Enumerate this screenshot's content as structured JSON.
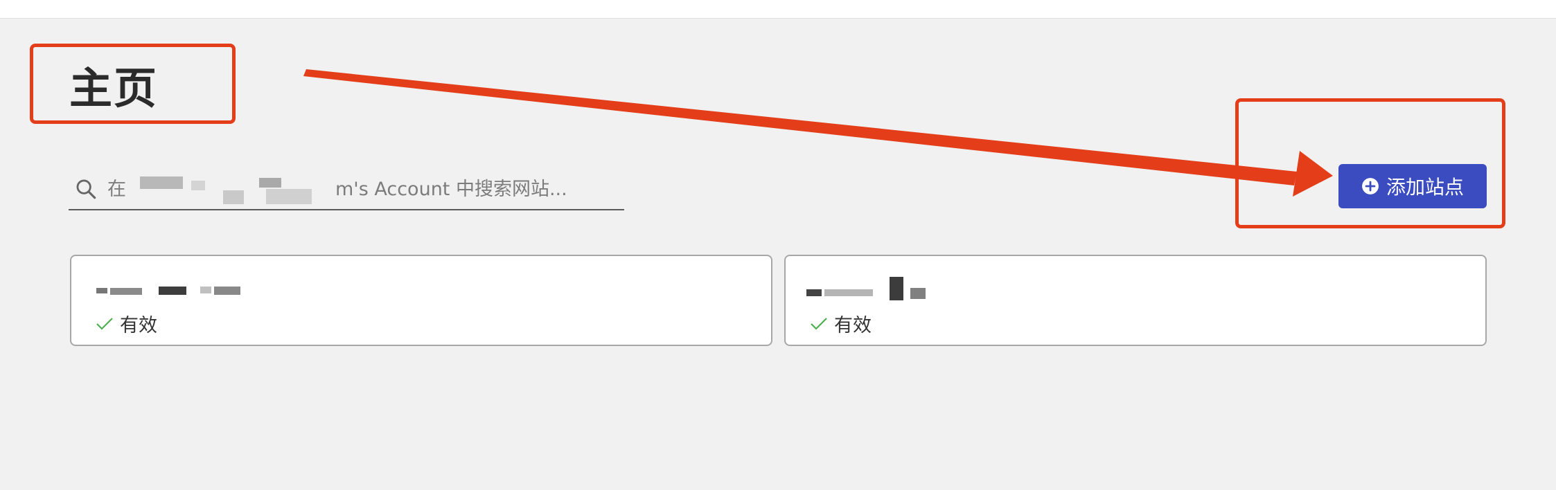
{
  "header": {
    "title": "主页"
  },
  "search": {
    "prefix": "在",
    "suffix": "m's Account 中搜索网站..."
  },
  "toolbar": {
    "add_site_label": "添加站点"
  },
  "sites": [
    {
      "status": "有效"
    },
    {
      "status": "有效"
    }
  ],
  "colors": {
    "accent": "#3a4cbf",
    "annotation": "#e33d1a",
    "status_ok": "#4caf50",
    "background": "#f1f1f1"
  },
  "icons": {
    "search": "search-icon",
    "add": "plus-circle-icon",
    "status": "check-icon"
  }
}
